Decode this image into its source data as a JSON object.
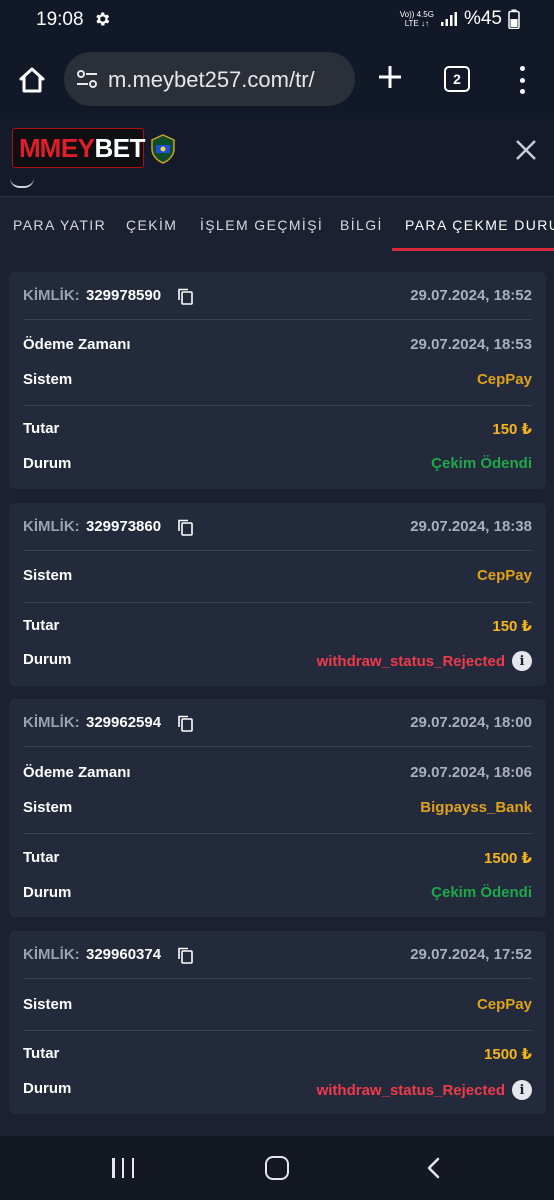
{
  "status_bar": {
    "time": "19:08",
    "network_top": "Vo)) 4.5G",
    "network_bottom": "LTE ↓↑",
    "battery": "%45"
  },
  "browser": {
    "url": "m.meybet257.com/tr/",
    "tab_count": "2"
  },
  "site": {
    "logo_mark": "M",
    "logo_text_red": "MEY",
    "logo_text_white": "BET"
  },
  "tabs": [
    {
      "label": "PARA YATIR"
    },
    {
      "label": "ÇEKİM"
    },
    {
      "label": "İŞLEM GEÇMİŞİ"
    },
    {
      "label": "BİLGİ"
    },
    {
      "label": "PARA ÇEKME DURUMU"
    }
  ],
  "cards": [
    {
      "kimlik_label": "KİMLİK:",
      "id": "329978590",
      "created": "29.07.2024, 18:52",
      "payment_time_label": "Ödeme Zamanı",
      "payment_time": "29.07.2024, 18:53",
      "system_label": "Sistem",
      "system": "CepPay",
      "amount_label": "Tutar",
      "amount": "150 ₺",
      "status_label": "Durum",
      "status": "Çekim Ödendi"
    },
    {
      "kimlik_label": "KİMLİK:",
      "id": "329973860",
      "created": "29.07.2024, 18:38",
      "system_label": "Sistem",
      "system": "CepPay",
      "amount_label": "Tutar",
      "amount": "150 ₺",
      "status_label": "Durum",
      "status": "withdraw_status_Rejected"
    },
    {
      "kimlik_label": "KİMLİK:",
      "id": "329962594",
      "created": "29.07.2024, 18:00",
      "payment_time_label": "Ödeme Zamanı",
      "payment_time": "29.07.2024, 18:06",
      "system_label": "Sistem",
      "system": "Bigpayss_Bank",
      "amount_label": "Tutar",
      "amount": "1500 ₺",
      "status_label": "Durum",
      "status": "Çekim Ödendi"
    },
    {
      "kimlik_label": "KİMLİK:",
      "id": "329960374",
      "created": "29.07.2024, 17:52",
      "system_label": "Sistem",
      "system": "CepPay",
      "amount_label": "Tutar",
      "amount": "1500 ₺",
      "status_label": "Durum",
      "status": "withdraw_status_Rejected"
    }
  ],
  "info_glyph": "i",
  "colors": {
    "background": "#1b2130",
    "card": "#222a3b",
    "accent_red": "#d8283a",
    "paid_green": "#1fa84a",
    "rejected_red": "#ef3a4c",
    "amount_gold": "#f5b51c"
  }
}
